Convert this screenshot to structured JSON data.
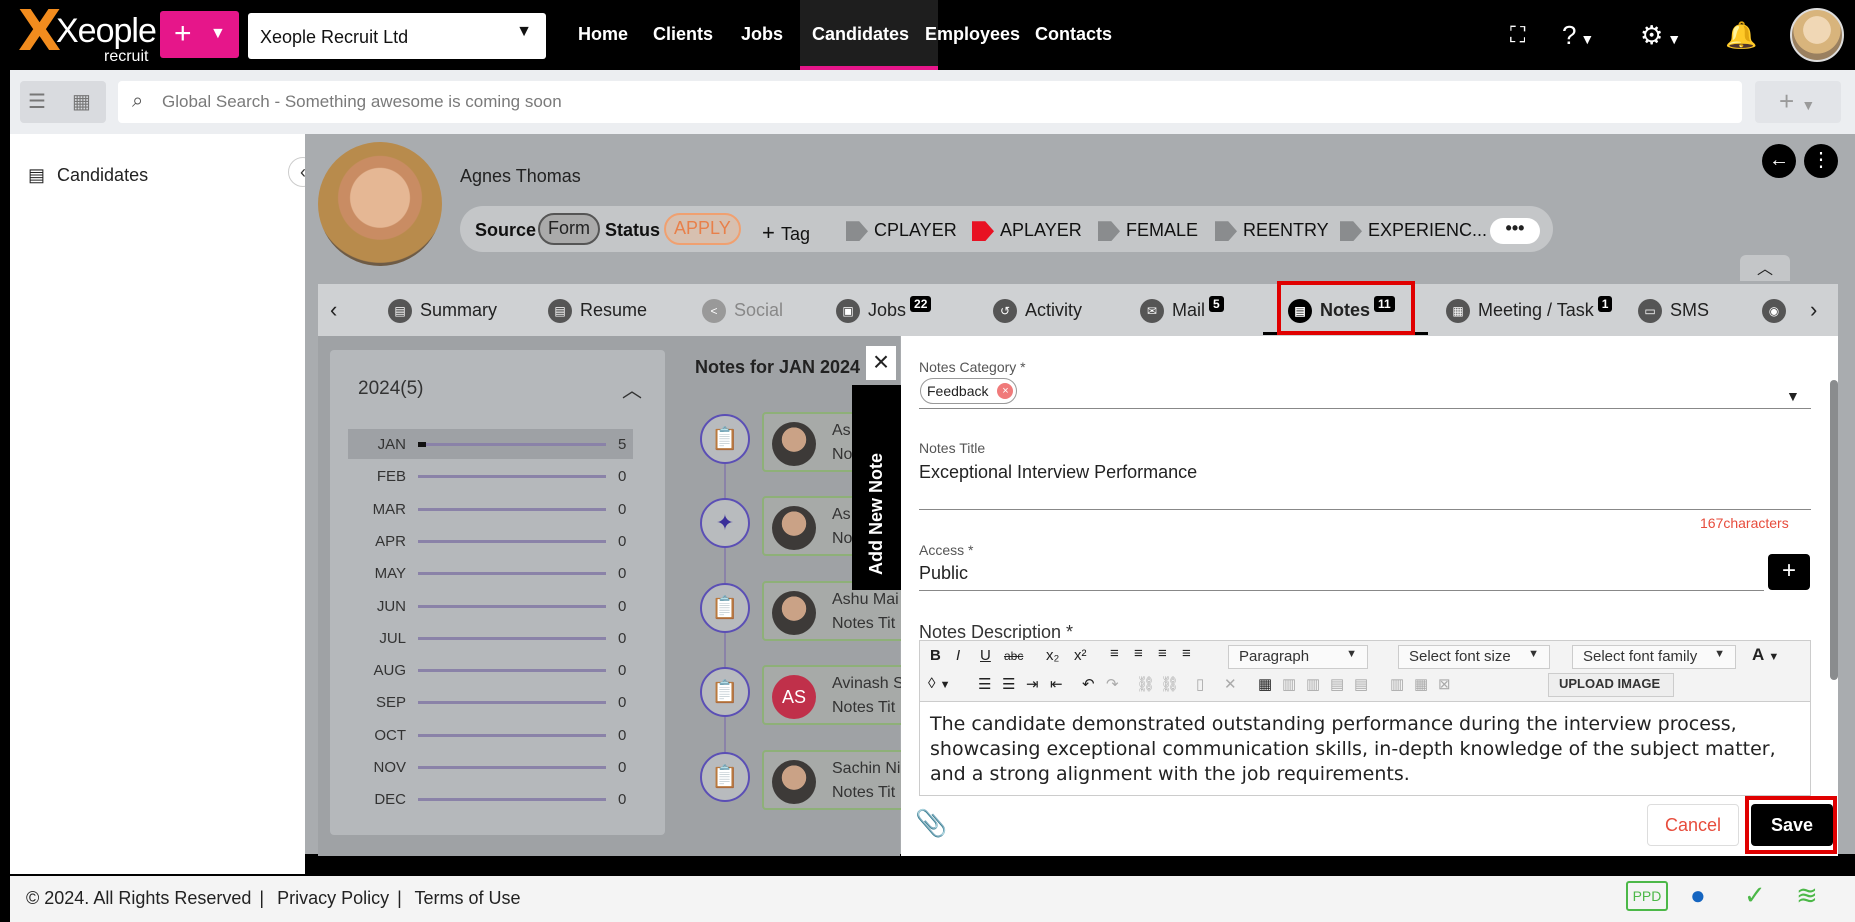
{
  "topbar": {
    "brand": "Xeople",
    "brand_sub": "recruit",
    "company": "Xeople Recruit Ltd",
    "nav": [
      "Home",
      "Clients",
      "Jobs",
      "Candidates",
      "Employees",
      "Contacts"
    ]
  },
  "search": {
    "placeholder": "Global Search - Something awesome is coming soon"
  },
  "sidebar": {
    "title": "Candidates"
  },
  "candidate": {
    "name": "Agnes Thomas",
    "source_label": "Source",
    "source_value": "Form",
    "status_label": "Status",
    "status_value": "APPLY",
    "add_tag": "Tag",
    "tags": [
      "CPLAYER",
      "APLAYER",
      "FEMALE",
      "REENTRY",
      "EXPERIENC..."
    ],
    "more": "•••"
  },
  "tabs": [
    {
      "label": "Summary"
    },
    {
      "label": "Resume"
    },
    {
      "label": "Social"
    },
    {
      "label": "Jobs",
      "badge": "22"
    },
    {
      "label": "Activity"
    },
    {
      "label": "Mail",
      "badge": "5"
    },
    {
      "label": "Notes",
      "badge": "11"
    },
    {
      "label": "Meeting / Task",
      "badge": "1"
    },
    {
      "label": "SMS"
    }
  ],
  "year_panel": {
    "title": "2024(5)",
    "months": [
      {
        "m": "JAN",
        "v": 5
      },
      {
        "m": "FEB",
        "v": 0
      },
      {
        "m": "MAR",
        "v": 0
      },
      {
        "m": "APR",
        "v": 0
      },
      {
        "m": "MAY",
        "v": 0
      },
      {
        "m": "JUN",
        "v": 0
      },
      {
        "m": "JUL",
        "v": 0
      },
      {
        "m": "AUG",
        "v": 0
      },
      {
        "m": "SEP",
        "v": 0
      },
      {
        "m": "OCT",
        "v": 0
      },
      {
        "m": "NOV",
        "v": 0
      },
      {
        "m": "DEC",
        "v": 0
      }
    ]
  },
  "notes_list": {
    "heading": "Notes for JAN 2024",
    "items": [
      {
        "line1": "As",
        "line2": "No"
      },
      {
        "line1": "As",
        "line2": "No"
      },
      {
        "line1": "Ashu Mai",
        "line2": "Notes Tit"
      },
      {
        "line1": "Avinash S",
        "line2": "Notes Tit",
        "initials": "AS"
      },
      {
        "line1": "Sachin Ni",
        "line2": "Notes Tit"
      }
    ]
  },
  "drawer": {
    "tab_label": "Add New Note",
    "category_label": "Notes Category *",
    "category_chip": "Feedback",
    "title_label": "Notes Title",
    "title_value": "Exceptional Interview Performance",
    "char_count": "167characters",
    "access_label": "Access *",
    "access_value": "Public",
    "desc_label": "Notes Description *",
    "paragraph": "Paragraph",
    "font_size": "Select font size",
    "font_family": "Select font family",
    "upload": "UPLOAD IMAGE",
    "body": "The candidate demonstrated outstanding performance during the interview process, showcasing exceptional communication skills, in-depth knowledge of the subject matter, and a strong alignment with the job requirements.",
    "cancel": "Cancel",
    "save": "Save"
  },
  "footer": {
    "copyright": "© 2024. All Rights Reserved",
    "privacy": "Privacy Policy",
    "terms": "Terms of Use",
    "ppd": "PPD"
  },
  "colors": {
    "accent": "#e6168a",
    "highlight": "#e00000",
    "success": "#4cb848"
  }
}
